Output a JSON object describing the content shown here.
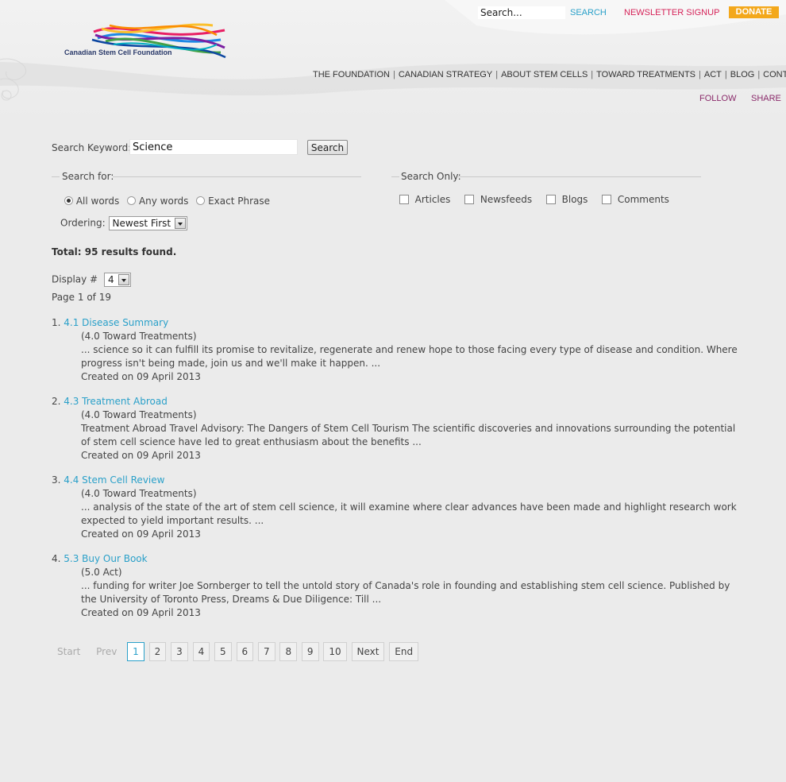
{
  "header": {
    "logo_text": "Canadian Stem Cell Foundation",
    "search_placeholder": "Search...",
    "search_value": "Search...",
    "search_label": "SEARCH",
    "newsletter_label": "NEWSLETTER SIGNUP",
    "donate_label": "DONATE",
    "nav": [
      "THE FOUNDATION",
      "CANADIAN STRATEGY",
      "ABOUT STEM CELLS",
      "TOWARD TREATMENTS",
      "ACT",
      "BLOG",
      "CONTACT"
    ],
    "follow_label": "FOLLOW",
    "share_label": "SHARE"
  },
  "search": {
    "keyword_label": "Search Keyword:",
    "keyword_value": "Science",
    "button_label": "Search",
    "search_for_label": "Search for:",
    "search_only_label": "Search Only:",
    "modes": [
      {
        "label": "All words",
        "selected": true
      },
      {
        "label": "Any words",
        "selected": false
      },
      {
        "label": "Exact Phrase",
        "selected": false
      }
    ],
    "areas": [
      "Articles",
      "Newsfeeds",
      "Blogs",
      "Comments"
    ],
    "ordering_label": "Ordering:",
    "ordering_value": "Newest First"
  },
  "summary": {
    "total": "Total: 95 results found.",
    "display_label": "Display #",
    "display_value": "4",
    "page_info": "Page 1 of 19"
  },
  "results": [
    {
      "num": "1.",
      "title": "4.1 Disease Summary",
      "section": "(4.0 Toward Treatments)",
      "snippet": "... science so it can fulfill its promise to revitalize, regenerate and renew hope to those facing every type of disease and condition. Where progress isn't being made, join us and we'll make it happen.  ...",
      "created": "Created on 09 April 2013"
    },
    {
      "num": "2.",
      "title": "4.3 Treatment Abroad",
      "section": "(4.0 Toward Treatments)",
      "snippet": "Treatment Abroad Travel Advisory: The Dangers of Stem Cell Tourism The scientific discoveries and innovations surrounding the potential of stem cell science have led to great enthusiasm about the benefits ...",
      "created": "Created on 09 April 2013"
    },
    {
      "num": "3.",
      "title": "4.4 Stem Cell Review",
      "section": "(4.0 Toward Treatments)",
      "snippet": "... analysis of the state of the art of stem cell science, it will examine where clear advances have been made and highlight research work expected to yield important results.          ...",
      "created": "Created on 09 April 2013"
    },
    {
      "num": "4.",
      "title": "5.3 Buy Our Book",
      "section": "(5.0 Act)",
      "snippet": "... funding for writer Joe Sornberger to tell the untold story of Canada's role in founding and establishing stem cell science. Published by the University of Toronto Press, Dreams & Due Diligence: Till ...",
      "created": "Created on 09 April 2013"
    }
  ],
  "pagination": {
    "start": "Start",
    "prev": "Prev",
    "pages": [
      "1",
      "2",
      "3",
      "4",
      "5",
      "6",
      "7",
      "8",
      "9",
      "10"
    ],
    "current": "1",
    "next": "Next",
    "end": "End"
  },
  "colors": {
    "link": "#2aa0c9",
    "newsletter": "#d6245a",
    "donate": "#f3a81b",
    "follow": "#8a2a6a"
  }
}
